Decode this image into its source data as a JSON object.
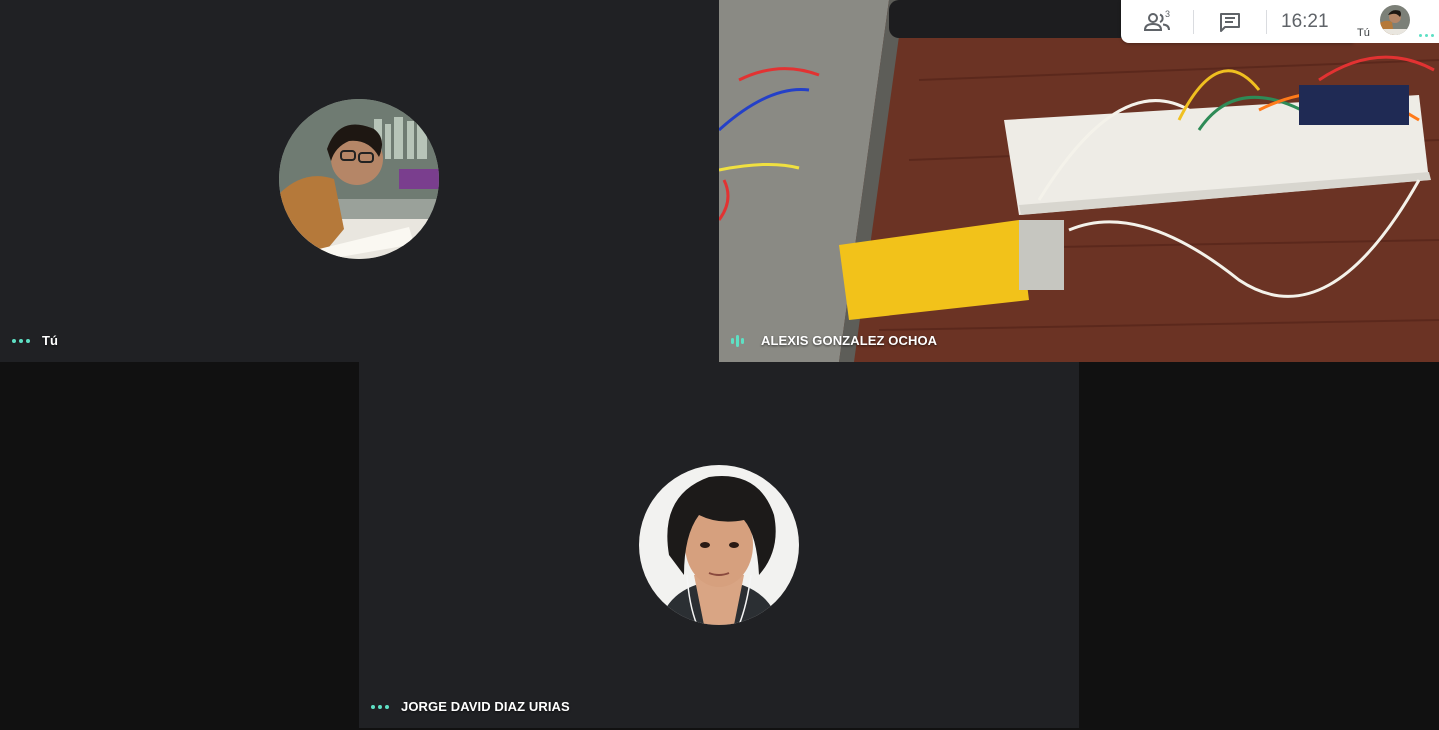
{
  "participants": {
    "self": {
      "name": "Tú"
    },
    "alexis": {
      "name": "ALEXIS GONZALEZ OCHOA"
    },
    "jorge": {
      "name": "JORGE DAVID DIAZ URIAS"
    }
  },
  "topbar": {
    "people_count": "3",
    "clock": "16:21",
    "self_label": "Tú"
  },
  "icons": {
    "people": "people-icon",
    "chat": "chat-icon",
    "more": "more-dots-icon",
    "speaking": "speaking-indicator-icon"
  },
  "colors": {
    "tile_bg": "#202124",
    "page_bg": "#111111",
    "accent": "#5ee0c4"
  }
}
